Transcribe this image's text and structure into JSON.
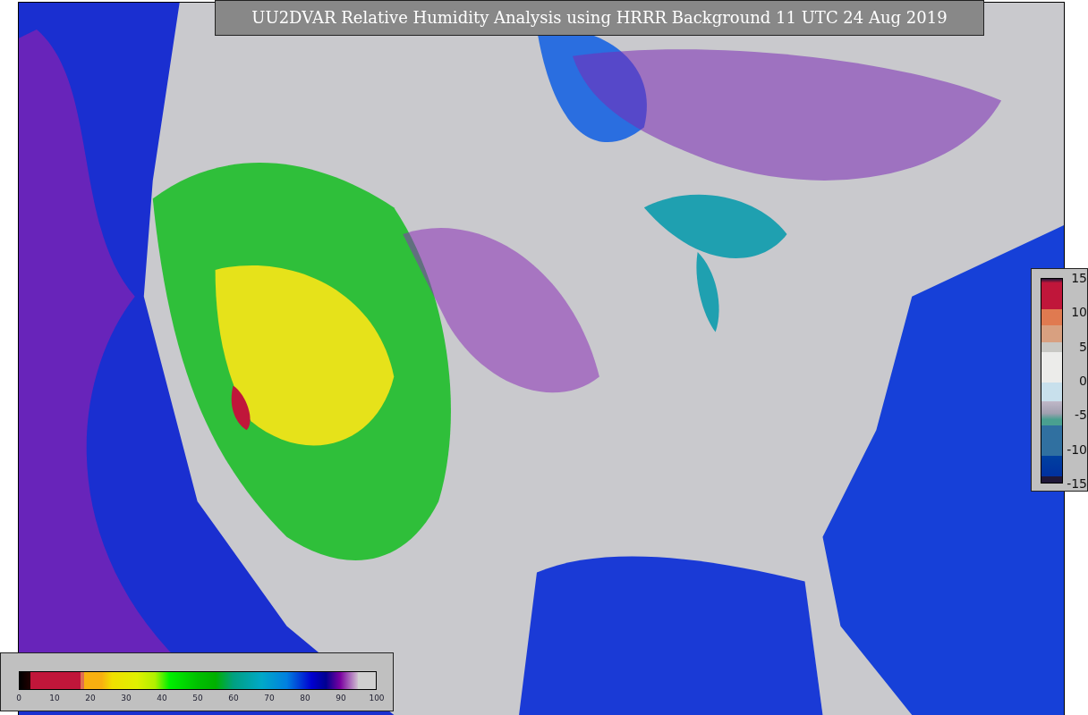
{
  "title": "UU2DVAR Relative Humidity Analysis using HRRR Background 11 UTC 24 Aug 2019",
  "humidity_colorbar": {
    "ticks": [
      "0",
      "10",
      "20",
      "30",
      "40",
      "50",
      "60",
      "70",
      "80",
      "90",
      "100"
    ]
  },
  "difference_colorbar": {
    "ticks": [
      "15",
      "10",
      "5",
      "0",
      "-5",
      "-10",
      "-15"
    ]
  }
}
